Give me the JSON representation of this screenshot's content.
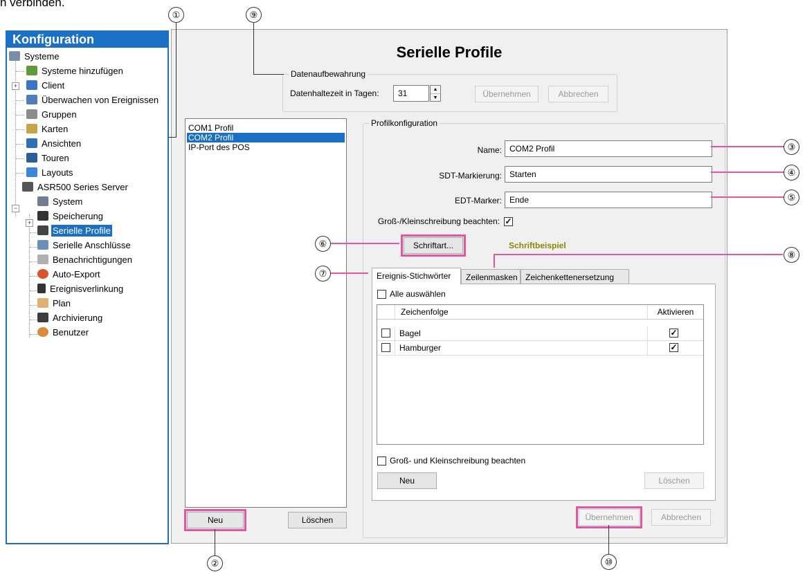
{
  "clipped_text": "n verbinden.",
  "tree": {
    "title": "Konfiguration",
    "items": [
      {
        "label": "Systeme",
        "icon": "server-group-icon"
      },
      {
        "label": "Systeme hinzufügen",
        "icon": "add-system-icon"
      },
      {
        "label": "Client",
        "icon": "client-gear-icon"
      },
      {
        "label": "Überwachen von Ereignissen",
        "icon": "monitor-events-icon"
      },
      {
        "label": "Gruppen",
        "icon": "groups-icon"
      },
      {
        "label": "Karten",
        "icon": "maps-icon"
      },
      {
        "label": "Ansichten",
        "icon": "views-icon"
      },
      {
        "label": "Touren",
        "icon": "tours-icon"
      },
      {
        "label": "Layouts",
        "icon": "layouts-icon"
      },
      {
        "label": "ASR500 Series Server",
        "icon": "server-icon"
      },
      {
        "label": "System",
        "icon": "system-icon"
      },
      {
        "label": "Speicherung",
        "icon": "storage-icon"
      },
      {
        "label": "Serielle Profile",
        "icon": "serial-profile-icon"
      },
      {
        "label": "Serielle Anschlüsse",
        "icon": "serial-port-icon"
      },
      {
        "label": "Benachrichtigungen",
        "icon": "notification-icon"
      },
      {
        "label": "Auto-Export",
        "icon": "auto-export-icon"
      },
      {
        "label": "Ereignisverlinkung",
        "icon": "event-link-icon"
      },
      {
        "label": "Plan",
        "icon": "schedule-icon"
      },
      {
        "label": "Archivierung",
        "icon": "archive-icon"
      },
      {
        "label": "Benutzer",
        "icon": "user-icon"
      }
    ],
    "selected_index": 12
  },
  "main": {
    "title": "Serielle Profile",
    "retention": {
      "legend": "Datenaufbewahrung",
      "days_label": "Datenhaltezeit in Tagen:",
      "days_value": "31",
      "apply_label": "Übernehmen",
      "cancel_label": "Abbrechen"
    },
    "profiles": {
      "items": [
        "COM1 Profil",
        "COM2 Profil",
        "IP-Port des POS"
      ],
      "selected_index": 1,
      "new_label": "Neu",
      "delete_label": "Löschen"
    },
    "config": {
      "legend": "Profilkonfiguration",
      "name_label": "Name:",
      "name_value": "COM2 Profil",
      "sdt_label": "SDT-Markierung:",
      "sdt_value": "Starten",
      "edt_label": "EDT-Marker:",
      "edt_value": "Ende",
      "case_label": "Groß-/Kleinschreibung beachten:",
      "case_checked": true,
      "font_button": "Schriftart...",
      "font_sample": "Schriftbeispiel",
      "font_sample_color": "#8a8a00",
      "tabs": [
        "Ereignis-Stichwörter",
        "Zeilenmasken",
        "Zeichenkettenersetzung"
      ],
      "active_tab": 0,
      "select_all_label": "Alle auswählen",
      "grid_headers": [
        "Zeichenfolge",
        "Aktivieren"
      ],
      "grid_rows": [
        {
          "text": "Bagel",
          "active": true
        },
        {
          "text": "Hamburger",
          "active": true
        }
      ],
      "grid_case_label": "Groß- und Kleinschreibung beachten",
      "grid_new_label": "Neu",
      "grid_delete_label": "Löschen",
      "apply_label": "Übernehmen",
      "cancel_label": "Abbrechen"
    }
  },
  "callouts": [
    "①",
    "②",
    "③",
    "④",
    "⑤",
    "⑥",
    "⑦",
    "⑧",
    "⑨",
    "⑩"
  ],
  "colors": {
    "accent": "#1b6fc4",
    "highlight": "#e0579f"
  }
}
